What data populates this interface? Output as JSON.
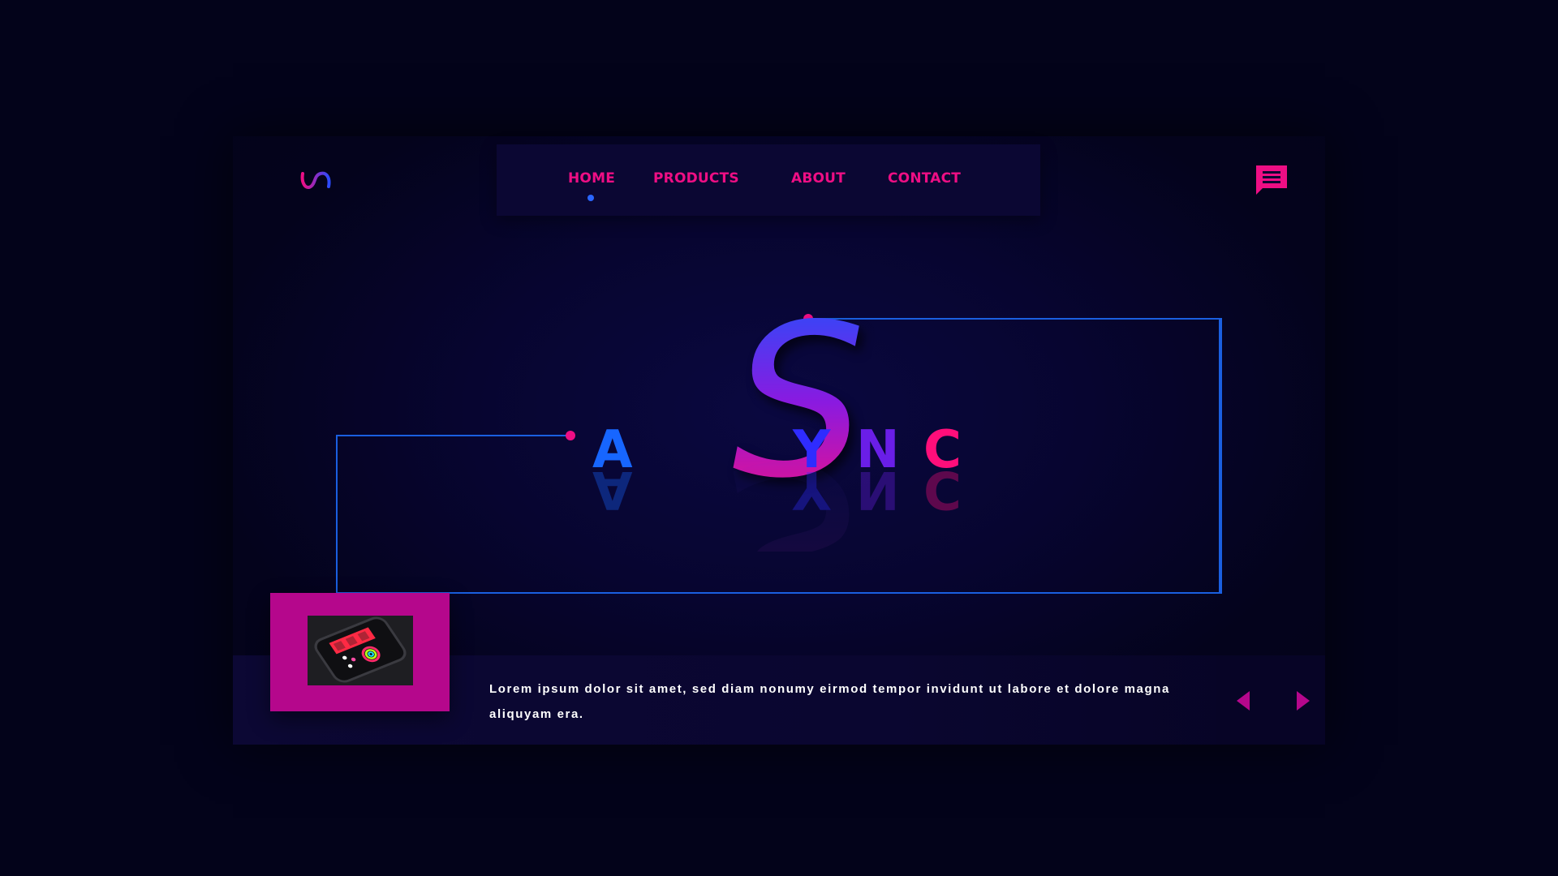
{
  "brand": {
    "logo_icon": "s-wave-logo-icon",
    "word_big_letter": "S",
    "word_letters": [
      "A",
      "Y",
      "N",
      "C"
    ]
  },
  "nav": {
    "items": [
      {
        "label": "HOME",
        "active": true
      },
      {
        "label": "PRODUCTS",
        "active": false
      },
      {
        "label": "ABOUT",
        "active": false
      },
      {
        "label": "CONTACT",
        "active": false
      }
    ]
  },
  "header": {
    "chat_icon": "chat-bubble-icon"
  },
  "slide": {
    "thumbnail_icon": "smartwatch-image",
    "caption": "Lorem ipsum dolor sit amet, sed diam nonumy eirmod tempor invidunt ut labore et dolore magna aliquyam era.",
    "prev_icon": "chevron-left-icon",
    "next_icon": "chevron-right-icon"
  },
  "colors": {
    "accent_pink": "#ee0e84",
    "accent_blue": "#1a5fe0",
    "background": "#03031a",
    "nav_bg": "#0b0733",
    "thumb_bg": "#b5078c"
  }
}
